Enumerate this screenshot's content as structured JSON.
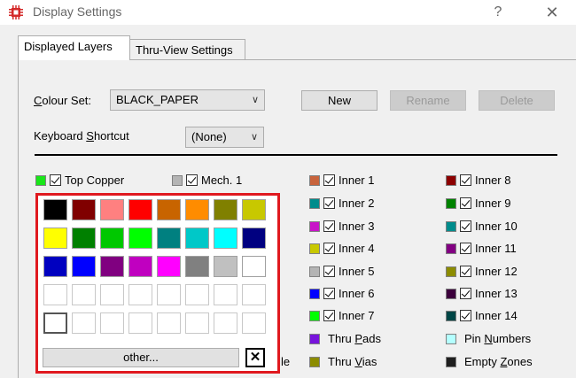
{
  "window": {
    "title": "Display Settings",
    "help_glyph": "?",
    "close_glyph": "✕"
  },
  "tabs": [
    {
      "label": "Displayed Layers",
      "active": true
    },
    {
      "label": "Thru-View Settings",
      "active": false
    }
  ],
  "colour_set": {
    "label_prefix": "C",
    "label_rest": "olour Set:",
    "value": "BLACK_PAPER"
  },
  "buttons": {
    "new": "New",
    "rename": "Rename",
    "delete": "Delete"
  },
  "keyboard_shortcut": {
    "label_pre": "Keyboard ",
    "label_u": "S",
    "label_post": "hortcut",
    "value": "(None)"
  },
  "layers": {
    "top_copper": {
      "label": "Top Copper",
      "color": "#19e619"
    },
    "mech1": {
      "label": "Mech. 1",
      "color": "#b4b4b4"
    },
    "col3": [
      {
        "label": "Inner 1",
        "color": "#c8643c"
      },
      {
        "label": "Inner 2",
        "color": "#008c8c"
      },
      {
        "label": "Inner 3",
        "color": "#c814c8"
      },
      {
        "label": "Inner 4",
        "color": "#c8c800"
      },
      {
        "label": "Inner 5",
        "color": "#b4b4b4"
      },
      {
        "label": "Inner 6",
        "color": "#0000ff"
      },
      {
        "label": "Inner 7",
        "color": "#00ff00"
      }
    ],
    "col4": [
      {
        "label": "Inner 8",
        "color": "#8c0000"
      },
      {
        "label": "Inner 9",
        "color": "#008200"
      },
      {
        "label": "Inner 10",
        "color": "#008c8c"
      },
      {
        "label": "Inner 11",
        "color": "#820082"
      },
      {
        "label": "Inner 12",
        "color": "#8c8c00"
      },
      {
        "label": "Inner 13",
        "color": "#3c003c"
      },
      {
        "label": "Inner 14",
        "color": "#004646"
      }
    ],
    "thru_pads": {
      "label_pre": "Thru ",
      "label_u": "P",
      "label_post": "ads",
      "color": "#7814dc"
    },
    "thru_vias": {
      "label_pre": "Thru ",
      "label_u": "V",
      "label_post": "ias",
      "color": "#8c8c00"
    },
    "pin_numbers": {
      "label_pre": "Pin ",
      "label_u": "N",
      "label_post": "umbers",
      "color": "#b4ffff"
    },
    "empty_zones": {
      "label_pre": "Empty ",
      "label_u": "Z",
      "label_post": "ones",
      "color": "#1e1e1e"
    }
  },
  "palette": {
    "colors": [
      "#000000",
      "#800000",
      "#ff8080",
      "#ff0000",
      "#c86400",
      "#ff8c00",
      "#808000",
      "#c8c800",
      "#ffff00",
      "#008000",
      "#00c800",
      "#00ff00",
      "#008080",
      "#00c8c8",
      "#00ffff",
      "#000080",
      "#0000c0",
      "#0000ff",
      "#800080",
      "#c000c0",
      "#ff00ff",
      "#808080",
      "#c0c0c0",
      "#ffffff"
    ],
    "custom_rows": 2,
    "other_label": "other...",
    "close_label": "✕"
  },
  "trailing_text": "le"
}
